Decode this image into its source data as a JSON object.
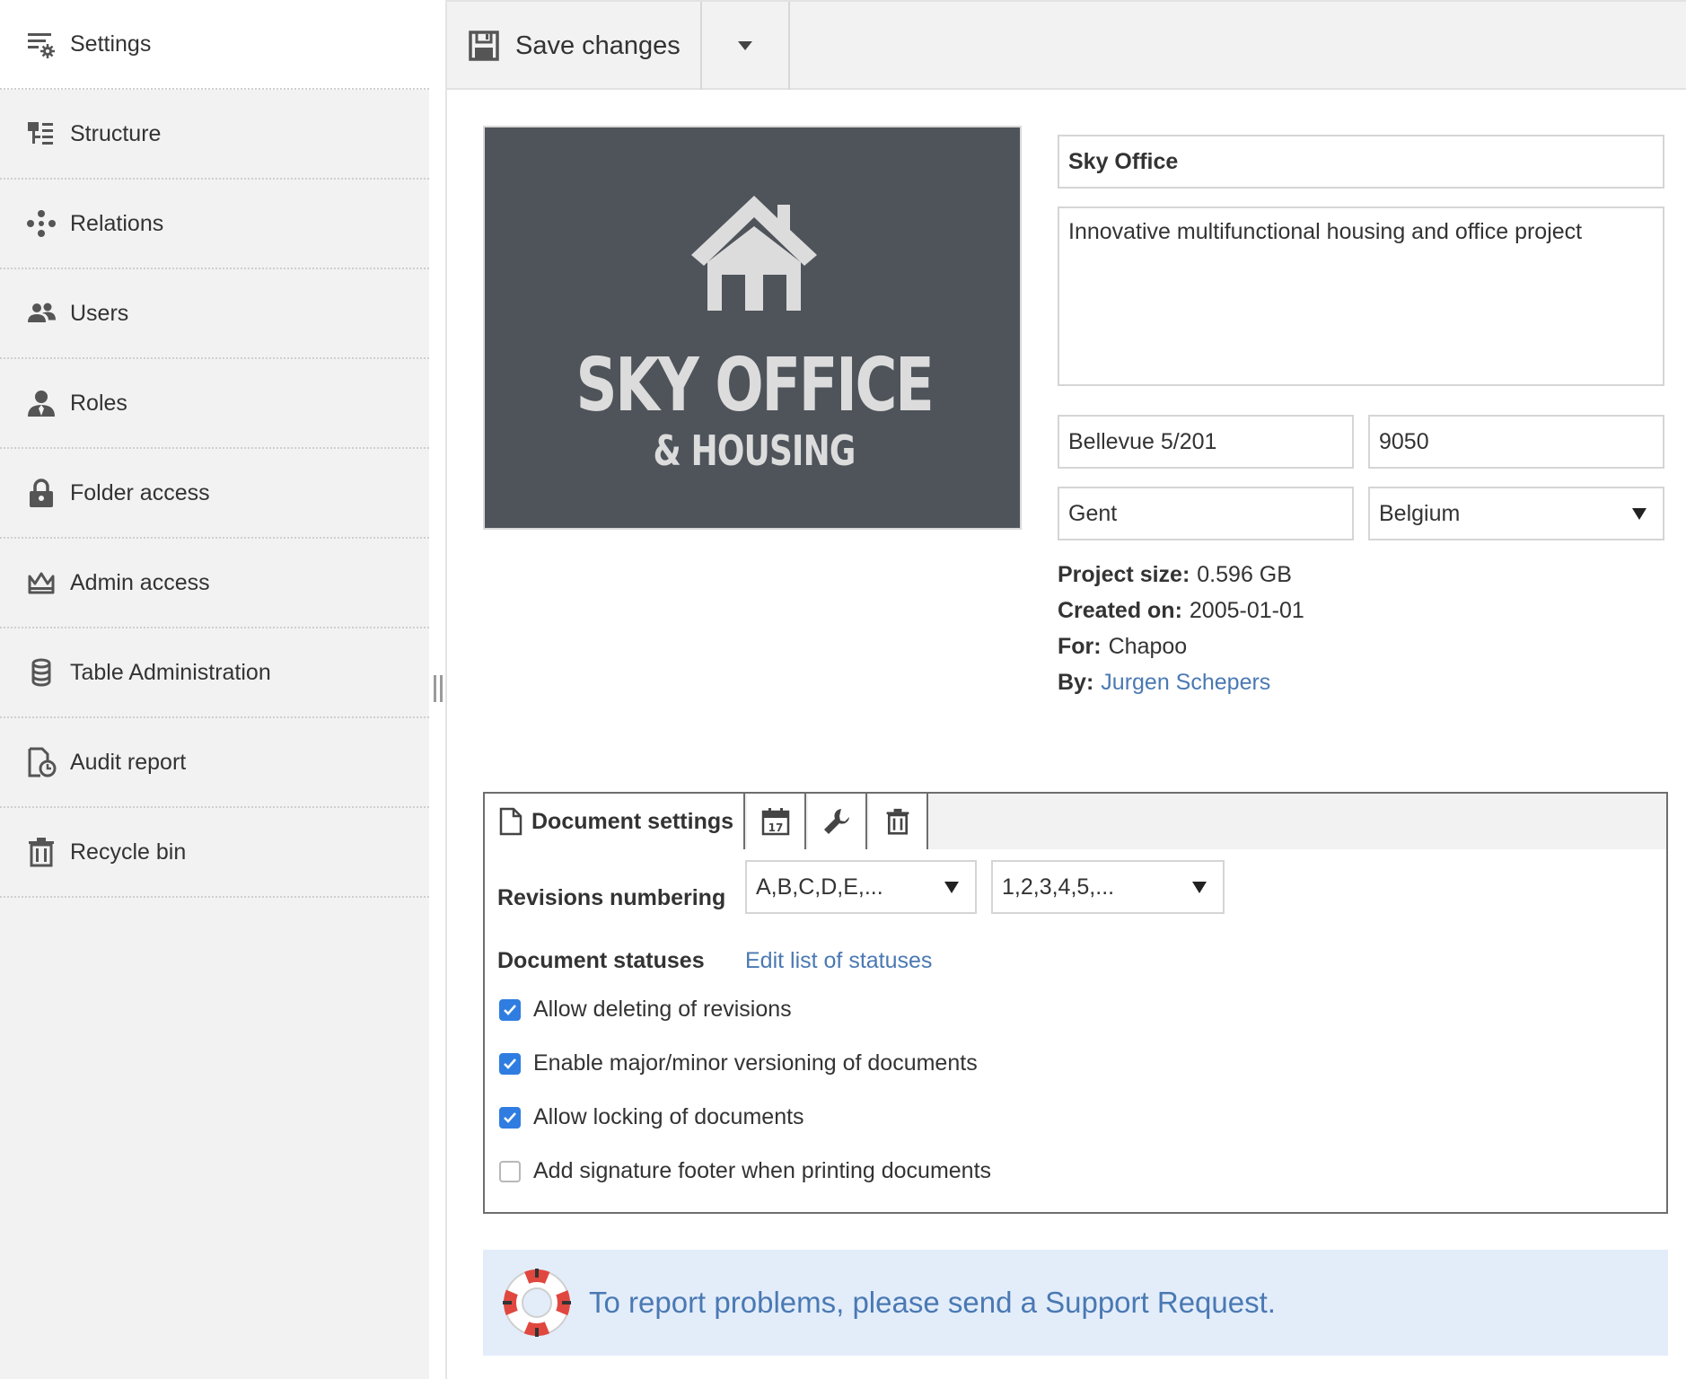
{
  "sidebar": {
    "items": [
      {
        "label": "Settings",
        "icon": "settings-icon",
        "active": true
      },
      {
        "label": "Structure",
        "icon": "structure-icon"
      },
      {
        "label": "Relations",
        "icon": "relations-icon"
      },
      {
        "label": "Users",
        "icon": "users-icon"
      },
      {
        "label": "Roles",
        "icon": "role-icon"
      },
      {
        "label": "Folder access",
        "icon": "lock-icon"
      },
      {
        "label": "Admin access",
        "icon": "crown-icon"
      },
      {
        "label": "Table Administration",
        "icon": "database-icon"
      },
      {
        "label": "Audit report",
        "icon": "audit-report-icon"
      },
      {
        "label": "Recycle bin",
        "icon": "trash-icon"
      }
    ]
  },
  "toolbar": {
    "save_label": "Save changes"
  },
  "logo": {
    "title": "SKY OFFICE",
    "subtitle": "& HOUSING",
    "background": "#4f545b"
  },
  "project": {
    "name": "Sky Office",
    "description": "Innovative multifunctional housing and office project",
    "street": "Bellevue 5/201",
    "postal_code": "9050",
    "city": "Gent",
    "country": "Belgium"
  },
  "info": {
    "size_label": "Project size:",
    "size_value": "0.596 GB",
    "created_label": "Created on:",
    "created_value": "2005-01-01",
    "for_label": "For:",
    "for_value": "Chapoo",
    "by_label": "By:",
    "by_value": "Jurgen Schepers"
  },
  "document_settings": {
    "tab_label": "Document settings",
    "revisions_label": "Revisions numbering",
    "revisions_major": "A,B,C,D,E,...",
    "revisions_minor": "1,2,3,4,5,...",
    "statuses_label": "Document statuses",
    "statuses_link": "Edit list of statuses",
    "options": [
      {
        "label": "Allow deleting of revisions",
        "checked": true
      },
      {
        "label": "Enable major/minor versioning of documents",
        "checked": true
      },
      {
        "label": "Allow locking of documents",
        "checked": true
      },
      {
        "label": "Add signature footer when printing documents",
        "checked": false
      }
    ]
  },
  "support": {
    "text": "To report problems, please send a Support Request."
  },
  "colors": {
    "accent": "#2f7de1",
    "link": "#4a79b3",
    "sidebar_bg": "#f2f2f2",
    "banner_bg": "#e3edfa"
  }
}
